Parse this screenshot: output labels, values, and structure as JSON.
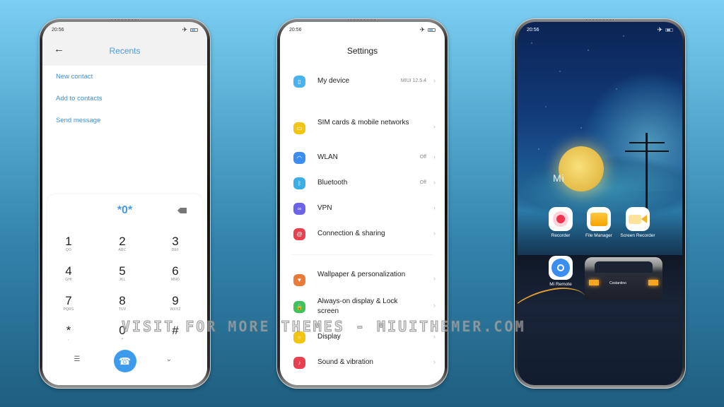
{
  "status_time": "20:56",
  "dialer": {
    "title": "Recents",
    "menu": [
      "New contact",
      "Add to contacts",
      "Send message"
    ],
    "display_value": "*0*",
    "keys": [
      {
        "num": "1",
        "letters": "QO"
      },
      {
        "num": "2",
        "letters": "ABC"
      },
      {
        "num": "3",
        "letters": "DEF"
      },
      {
        "num": "4",
        "letters": "GHI"
      },
      {
        "num": "5",
        "letters": "JKL"
      },
      {
        "num": "6",
        "letters": "MNO"
      },
      {
        "num": "7",
        "letters": "PQRS"
      },
      {
        "num": "8",
        "letters": "TUV"
      },
      {
        "num": "9",
        "letters": "WXYZ"
      },
      {
        "num": "*",
        "letters": ","
      },
      {
        "num": "0",
        "letters": "+"
      },
      {
        "num": "#",
        "letters": ""
      }
    ],
    "call_icon": "☎",
    "accent": "#3d9bee"
  },
  "settings": {
    "title": "Settings",
    "items": [
      {
        "label": "My device",
        "value": "MIUI 12.5.4",
        "color": "#49b3f0",
        "glyph": "▯"
      },
      {
        "label": "SIM cards & mobile networks",
        "value": "",
        "color": "#f2c511",
        "glyph": "▭"
      },
      {
        "label": "WLAN",
        "value": "Off",
        "color": "#3b8ef0",
        "glyph": "◠"
      },
      {
        "label": "Bluetooth",
        "value": "Off",
        "color": "#3aaee8",
        "glyph": "ᛒ"
      },
      {
        "label": "VPN",
        "value": "",
        "color": "#6b63e8",
        "glyph": "∞"
      },
      {
        "label": "Connection & sharing",
        "value": "",
        "color": "#e8404e",
        "glyph": "@"
      },
      {
        "label": "Wallpaper & personalization",
        "value": "",
        "color": "#e87a3a",
        "glyph": "▼"
      },
      {
        "label": "Always-on display & Lock screen",
        "value": "",
        "color": "#3ec25a",
        "glyph": "🔒"
      },
      {
        "label": "Display",
        "value": "",
        "color": "#f2c511",
        "glyph": "○"
      },
      {
        "label": "Sound & vibration",
        "value": "",
        "color": "#e8404e",
        "glyph": "♪"
      }
    ]
  },
  "home": {
    "logo": "Mi",
    "plate": "Costantino",
    "apps": [
      {
        "label": "Recorder"
      },
      {
        "label": "File Manager"
      },
      {
        "label": "Screen Recorder"
      },
      {
        "label": "Mi Remote"
      }
    ]
  },
  "watermark": "VISIT FOR MORE THEMES - MIUITHEMER.COM"
}
